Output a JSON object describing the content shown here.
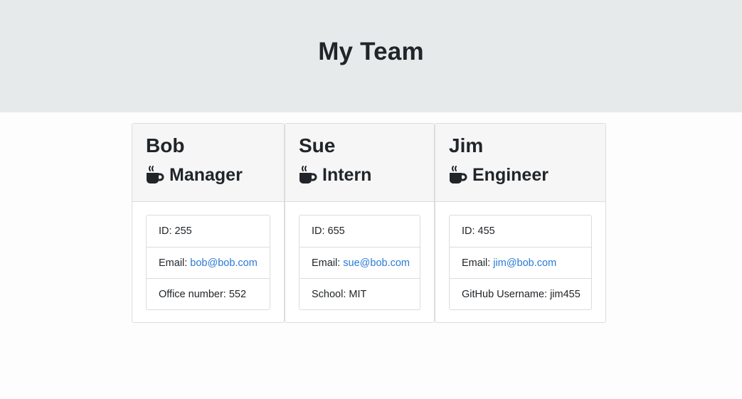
{
  "header": {
    "title": "My Team"
  },
  "cards": [
    {
      "name": "Bob",
      "role": "Manager",
      "role_icon": "coffee-mug-icon",
      "id_label": "ID:",
      "id_value": "255",
      "email_label": "Email:",
      "email_value": "bob@bob.com",
      "extra_label": "Office number:",
      "extra_value": "552"
    },
    {
      "name": "Sue",
      "role": "Intern",
      "role_icon": "coffee-mug-icon",
      "id_label": "ID:",
      "id_value": "655",
      "email_label": "Email:",
      "email_value": "sue@bob.com",
      "extra_label": "School:",
      "extra_value": "MIT"
    },
    {
      "name": "Jim",
      "role": "Engineer",
      "role_icon": "coffee-mug-icon",
      "id_label": "ID:",
      "id_value": "455",
      "email_label": "Email:",
      "email_value": "jim@bob.com",
      "extra_label": "GitHub Username:",
      "extra_value": "jim455"
    }
  ],
  "colors": {
    "header_bg": "#e7eaeb",
    "link": "#2a7ad5",
    "card_head_bg": "#f6f6f6"
  }
}
